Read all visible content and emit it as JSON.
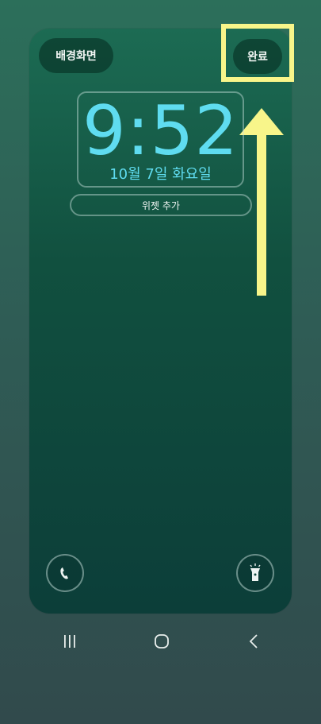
{
  "header": {
    "wallpaper_label": "배경화면",
    "done_label": "완료"
  },
  "lockscreen": {
    "time": "9:52",
    "date": "10월 7일 화요일",
    "add_widget_label": "위젯 추가"
  },
  "shortcuts": {
    "left_icon": "phone-icon",
    "right_icon": "flashlight-icon"
  },
  "navbar": {
    "items": [
      "recent-apps-icon",
      "home-icon",
      "back-icon"
    ]
  },
  "colors": {
    "clock": "#5fdcf0",
    "highlight": "#f8f58a",
    "card_top": "#1c6b53",
    "card_bottom": "#0c3e39"
  }
}
